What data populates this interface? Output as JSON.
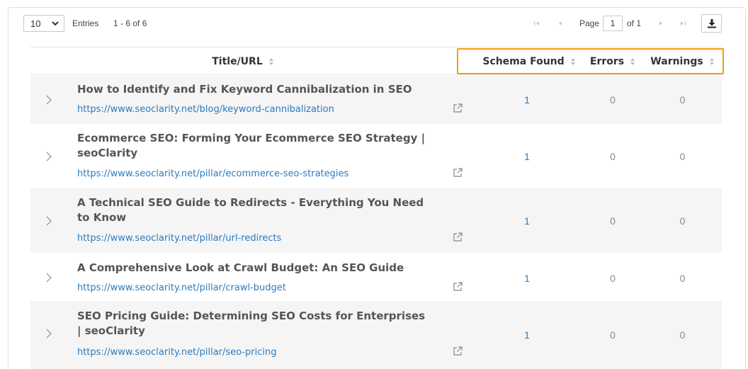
{
  "toolbar": {
    "page_size": "10",
    "entries_label": "Entries",
    "entries_range": "1 - 6 of 6",
    "page_label": "Page",
    "page_number": "1",
    "of_label": "of 1"
  },
  "table": {
    "columns": {
      "title": "Title/URL",
      "schema": "Schema Found",
      "errors": "Errors",
      "warnings": "Warnings"
    },
    "rows": [
      {
        "title": "How to Identify and Fix Keyword Cannibalization in SEO",
        "url": "https://www.seoclarity.net/blog/keyword-cannibalization",
        "schema": "1",
        "errors": "0",
        "warnings": "0"
      },
      {
        "title": "Ecommerce SEO: Forming Your Ecommerce SEO Strategy | seoClarity",
        "url": "https://www.seoclarity.net/pillar/ecommerce-seo-strategies",
        "schema": "1",
        "errors": "0",
        "warnings": "0"
      },
      {
        "title": "A Technical SEO Guide to Redirects - Everything You Need to Know",
        "url": "https://www.seoclarity.net/pillar/url-redirects",
        "schema": "1",
        "errors": "0",
        "warnings": "0"
      },
      {
        "title": "A Comprehensive Look at Crawl Budget: An SEO Guide",
        "url": "https://www.seoclarity.net/pillar/crawl-budget",
        "schema": "1",
        "errors": "0",
        "warnings": "0"
      },
      {
        "title": "SEO Pricing Guide: Determining SEO Costs for Enterprises | seoClarity",
        "url": "https://www.seoclarity.net/pillar/seo-pricing",
        "schema": "1",
        "errors": "0",
        "warnings": "0"
      }
    ]
  },
  "colors": {
    "highlight": "#f39c12",
    "link": "#2b7bc0",
    "row_alt": "#f5f5f5"
  },
  "icons": {
    "page_size_dropdown": "chevron-down-icon",
    "first_page": "first-page-icon",
    "prev_page": "prev-page-icon",
    "next_page": "next-page-icon",
    "last_page": "last-page-icon",
    "download": "download-icon",
    "sort": "sort-icon",
    "expand": "chevron-right-icon",
    "open_link": "external-link-icon"
  }
}
